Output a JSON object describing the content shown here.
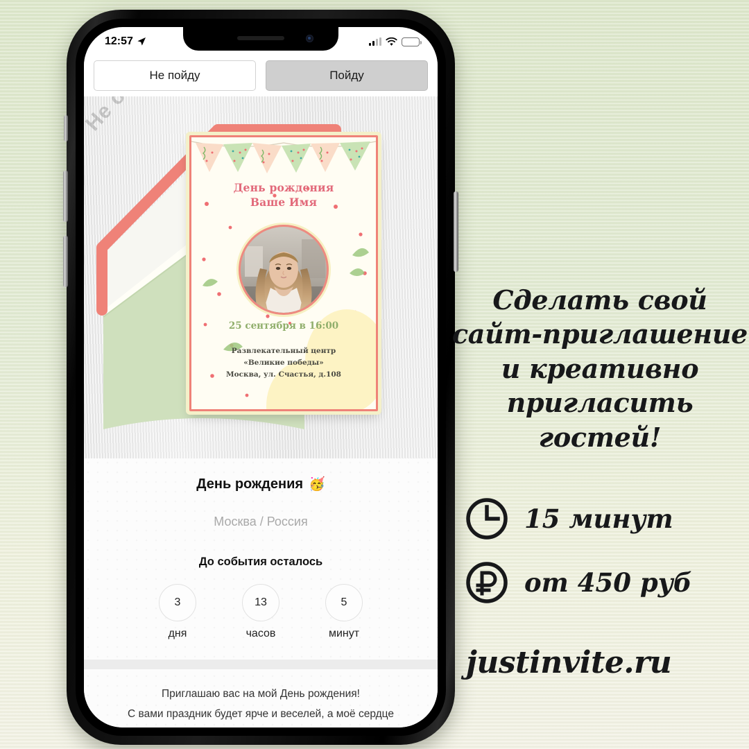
{
  "background": {
    "color_top": "#dde7cb",
    "color_bottom": "#f3f2e6"
  },
  "phone": {
    "statusbar": {
      "time": "12:57",
      "location_icon": "location-arrow-icon",
      "signal_icon": "cellular-signal-icon",
      "wifi_icon": "wifi-icon",
      "battery_icon": "battery-icon",
      "battery_color": "#f5c518"
    },
    "tabs": [
      {
        "label": "Не пойду",
        "active": false
      },
      {
        "label": "Пойду",
        "active": true
      }
    ],
    "hero": {
      "watermark": "Не определено",
      "envelope": {
        "flap_color": "#ef8278",
        "body_color": "#cfe0bd",
        "liner_color": "#f7f7f2"
      },
      "card": {
        "title_line1": "День рождения",
        "title_line2": "Ваше Имя",
        "title_color": "#e2697a",
        "date": "25 сентября в 16:00",
        "date_color": "#8fae6b",
        "venue_line1": "Развлекательный центр",
        "venue_line2": "«Великие победы»",
        "venue_line3": "Москва, ул. Счастья, д.108",
        "border_color": "#ef8278",
        "accent_color": "#f4f0c9",
        "photo_alt": "portrait-photo"
      }
    },
    "event": {
      "title": "День рождения",
      "title_emoji": "🥳",
      "location": "Москва / Россия",
      "countdown_heading": "До события осталось",
      "countdown": [
        {
          "value": "3",
          "label": "дня"
        },
        {
          "value": "13",
          "label": "часов"
        },
        {
          "value": "5",
          "label": "минут"
        }
      ],
      "invite_line1": "Приглашаю вас на мой День рождения!",
      "invite_line2": "С вами праздник будет ярче и веселей, а моё сердце счастливее!"
    }
  },
  "promo": {
    "headline_line1": "Сделать свой",
    "headline_line2": "сайт-приглашение",
    "headline_line3": "и креативно",
    "headline_line4": "пригласить гостей!",
    "features": [
      {
        "icon": "clock-icon",
        "text": "15 минут"
      },
      {
        "icon": "ruble-icon",
        "text": "от 450 руб"
      }
    ],
    "url": "justinvite.ru"
  }
}
